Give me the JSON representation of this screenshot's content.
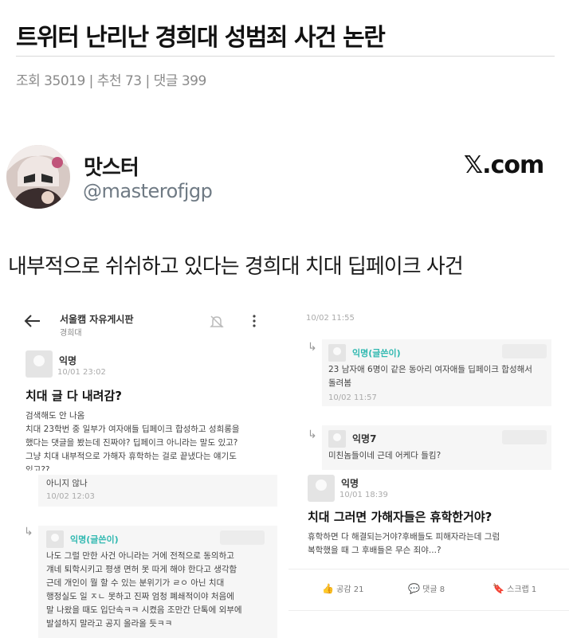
{
  "post": {
    "title": "트위터 난리난 경희대 성범죄 사건 논란",
    "meta": "조회 35019 | 추천 73 | 댓글 399"
  },
  "tweet": {
    "name": "맛스터",
    "handle": "@masterofjgp",
    "brand": "𝕏.com",
    "text": "내부적으로 쉬쉬하고 있다는 경희대 치대 딥페이크 사건"
  },
  "left": {
    "header_title": "서울캠 자유게시판",
    "header_sub": "경희대",
    "post_author": "익명",
    "post_date": "10/01 23:02",
    "post_title": "치대 글 다 내려감?",
    "post_body": [
      "검색해도 안 나옴",
      "치대 23학번 중 일부가 여자애들 딥페이크 합성하고 성희롱을",
      "했다는 댓글을 봤는데 진짜야? 딥페이크 아니라는 말도 있고?",
      "그냥 치대 내부적으로 가해자 휴학하는 걸로 끝냈다는 얘기도",
      "있고??"
    ],
    "reply1_text": "아니지 않나",
    "reply1_date": "10/02 12:03",
    "reply2_author": "익명(글쓴이)",
    "reply2_body": [
      "나도 그럴 만한 사건 아니라는 거에 전적으로 동의하고",
      "걔네 퇴학시키고 평생 면허 못 따게 해야 한다고 생각함",
      "근데 개인이 뭘 할 수 있는 분위기가 ㄹㅇ 아닌 치대",
      "행정실도 일 ㅈㄴ 못하고 진짜 엄청 폐쇄적이야 처음에",
      "말 나왔을 때도 입단속ㅋㅋ 시켰음 조만간 단톡에 외부에",
      "발설하지 말라고 공지 올라올 듯ㅋㅋ"
    ]
  },
  "right": {
    "top_date": "10/02 11:55",
    "c1_author": "익명(글쓴이)",
    "c1_text": "23 남자애 6명이 같은 동아리 여자애들 딥페이크 합성해서",
    "c1_text2": "돌려봄",
    "c1_date": "10/02 11:57",
    "c2_author": "익명7",
    "c2_text": "미친놈들이네 근데 어케다 들킴?",
    "p2_author": "익명",
    "p2_date": "10/01 18:39",
    "p2_title": "치대 그러면 가해자들은 휴학한거야?",
    "p2_body": [
      "휴학하면 다 해결되는거야?후배들도 피해자라는데 그럼",
      "복학했을 때 그 후배들은 무슨 죄야...?"
    ],
    "likes": "공감 21",
    "comments": "댓글 8",
    "scrap": "스크랩 1"
  },
  "colors": {
    "teal": "#2fb8b0",
    "muted": "#8a8a8a"
  }
}
